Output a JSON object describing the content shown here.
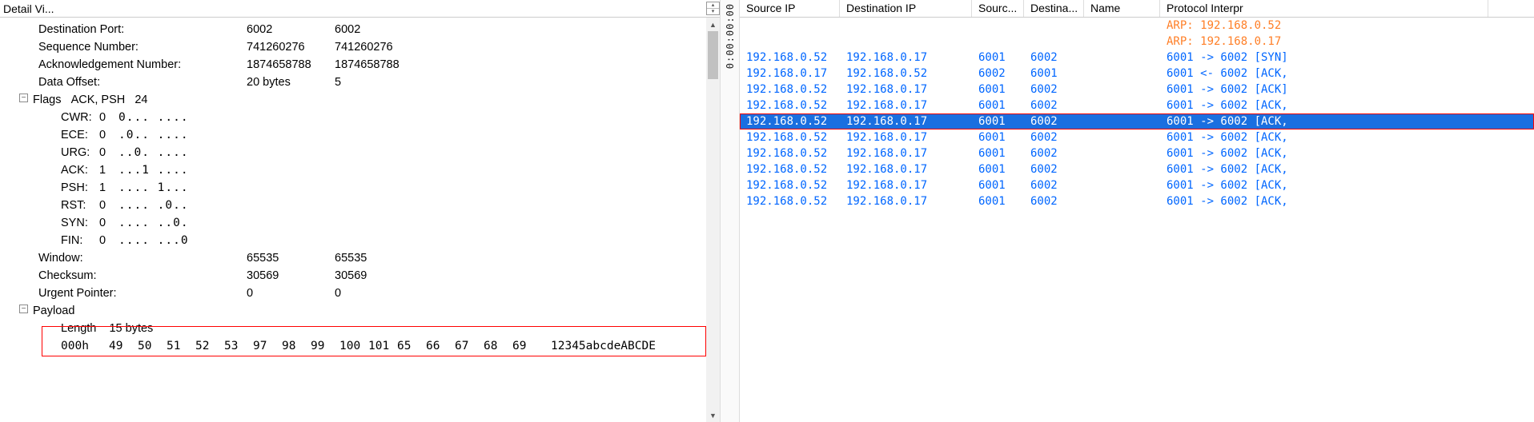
{
  "detail": {
    "title": "Detail Vi...",
    "fields": {
      "dest_port": {
        "label": "Destination Port:",
        "v1": "6002",
        "v2": "6002"
      },
      "seq_num": {
        "label": "Sequence Number:",
        "v1": "741260276",
        "v2": "741260276"
      },
      "ack_num": {
        "label": "Acknowledgement Number:",
        "v1": "1874658788",
        "v2": "1874658788"
      },
      "data_off": {
        "label": "Data Offset:",
        "v1": "20 bytes",
        "v2": "5"
      },
      "flags_hdr": {
        "label": "Flags",
        "txt": "ACK, PSH",
        "val": "24"
      },
      "flags": [
        {
          "name": "CWR:",
          "v": "0",
          "bits": "0... ...."
        },
        {
          "name": "ECE:",
          "v": "0",
          "bits": ".0.. ...."
        },
        {
          "name": "URG:",
          "v": "0",
          "bits": "..0. ...."
        },
        {
          "name": "ACK:",
          "v": "1",
          "bits": "...1 ...."
        },
        {
          "name": "PSH:",
          "v": "1",
          "bits": ".... 1..."
        },
        {
          "name": "RST:",
          "v": "0",
          "bits": ".... .0.."
        },
        {
          "name": "SYN:",
          "v": "0",
          "bits": ".... ..0."
        },
        {
          "name": "FIN:",
          "v": "0",
          "bits": ".... ...0"
        }
      ],
      "window": {
        "label": "Window:",
        "v1": "65535",
        "v2": "65535"
      },
      "checksum": {
        "label": "Checksum:",
        "v1": "30569",
        "v2": "30569"
      },
      "urgent": {
        "label": "Urgent Pointer:",
        "v1": "0",
        "v2": "0"
      },
      "payload_hdr": "Payload",
      "length": {
        "label": "Length",
        "v": "15 bytes"
      },
      "hexrow": {
        "addr": "000h",
        "bytes": [
          "49",
          "50",
          "51",
          "52",
          "53",
          "97",
          "98",
          "99",
          "100",
          "101",
          "65",
          "66",
          "67",
          "68",
          "69"
        ],
        "ascii": "12345abcdeABCDE"
      }
    }
  },
  "middle_ts": "0:00:00:00",
  "right": {
    "columns": [
      "Source IP",
      "Destination IP",
      "Sourc...",
      "Destina...",
      "Name",
      "Protocol Interpr"
    ],
    "rows": [
      {
        "src": "",
        "dst": "",
        "sp": "",
        "dp": "",
        "nm": "",
        "pi": "ARP: 192.168.0.52",
        "cls": "orange"
      },
      {
        "src": "",
        "dst": "",
        "sp": "",
        "dp": "",
        "nm": "",
        "pi": "ARP: 192.168.0.17",
        "cls": "orange"
      },
      {
        "src": "192.168.0.52",
        "dst": "192.168.0.17",
        "sp": "6001",
        "dp": "6002",
        "nm": "",
        "pi": "6001 -> 6002 [SYN]",
        "cls": "blue"
      },
      {
        "src": "192.168.0.17",
        "dst": "192.168.0.52",
        "sp": "6002",
        "dp": "6001",
        "nm": "",
        "pi": "6001 <- 6002 [ACK,",
        "cls": "blue"
      },
      {
        "src": "192.168.0.52",
        "dst": "192.168.0.17",
        "sp": "6001",
        "dp": "6002",
        "nm": "",
        "pi": "6001 -> 6002 [ACK]",
        "cls": "blue"
      },
      {
        "src": "192.168.0.52",
        "dst": "192.168.0.17",
        "sp": "6001",
        "dp": "6002",
        "nm": "",
        "pi": "6001 -> 6002 [ACK,",
        "cls": "blue"
      },
      {
        "src": "192.168.0.52",
        "dst": "192.168.0.17",
        "sp": "6001",
        "dp": "6002",
        "nm": "",
        "pi": "6001 -> 6002 [ACK,",
        "cls": "blue",
        "selected": true
      },
      {
        "src": "192.168.0.52",
        "dst": "192.168.0.17",
        "sp": "6001",
        "dp": "6002",
        "nm": "",
        "pi": "6001 -> 6002 [ACK,",
        "cls": "blue"
      },
      {
        "src": "192.168.0.52",
        "dst": "192.168.0.17",
        "sp": "6001",
        "dp": "6002",
        "nm": "",
        "pi": "6001 -> 6002 [ACK,",
        "cls": "blue"
      },
      {
        "src": "192.168.0.52",
        "dst": "192.168.0.17",
        "sp": "6001",
        "dp": "6002",
        "nm": "",
        "pi": "6001 -> 6002 [ACK,",
        "cls": "blue"
      },
      {
        "src": "192.168.0.52",
        "dst": "192.168.0.17",
        "sp": "6001",
        "dp": "6002",
        "nm": "",
        "pi": "6001 -> 6002 [ACK,",
        "cls": "blue"
      },
      {
        "src": "192.168.0.52",
        "dst": "192.168.0.17",
        "sp": "6001",
        "dp": "6002",
        "nm": "",
        "pi": "6001 -> 6002 [ACK,",
        "cls": "blue"
      }
    ]
  }
}
